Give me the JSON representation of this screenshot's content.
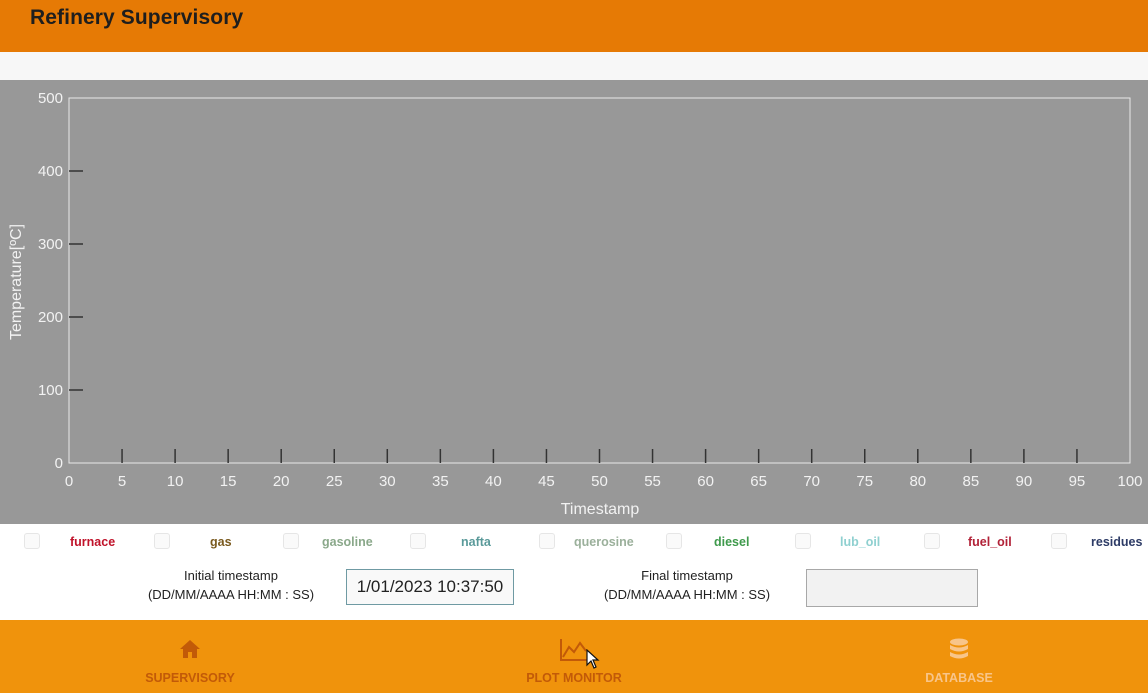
{
  "header": {
    "title": "Refinery Supervisory"
  },
  "colors": {
    "header_bg": "#e67a05",
    "nav_bg": "#f0930c",
    "plot_bg": "#989898"
  },
  "chart_data": {
    "type": "line",
    "xlabel": "Timestamp",
    "ylabel": "Temperature[ºC]",
    "xlim": [
      0,
      100
    ],
    "ylim": [
      0,
      500
    ],
    "x_ticks": [
      0,
      5,
      10,
      15,
      20,
      25,
      30,
      35,
      40,
      45,
      50,
      55,
      60,
      65,
      70,
      75,
      80,
      85,
      90,
      95,
      100
    ],
    "y_ticks": [
      0,
      100,
      200,
      300,
      400,
      500
    ],
    "series": []
  },
  "legend": {
    "items": [
      {
        "label": "furnace",
        "color": "#c0122a"
      },
      {
        "label": "gas",
        "color": "#7a5a1e"
      },
      {
        "label": "gasoline",
        "color": "#8aa88a"
      },
      {
        "label": "nafta",
        "color": "#5a9a9a"
      },
      {
        "label": "querosine",
        "color": "#9bb09b"
      },
      {
        "label": "diesel",
        "color": "#3f9a4c"
      },
      {
        "label": "lub_oil",
        "color": "#8fd0d0"
      },
      {
        "label": "fuel_oil",
        "color": "#b22238"
      },
      {
        "label": "residues",
        "color": "#2d3b66"
      }
    ]
  },
  "filters": {
    "initial_label": "Initial timestamp",
    "initial_format": "(DD/MM/AAAA HH:MM : SS)",
    "initial_value": "1/01/2023 10:37:50",
    "final_label": "Final timestamp",
    "final_format": "(DD/MM/AAAA HH:MM : SS)",
    "final_value": ""
  },
  "nav": {
    "items": [
      {
        "label": "SUPERVISORY",
        "icon": "home-icon",
        "color": "#c25a08"
      },
      {
        "label": "PLOT MONITOR",
        "icon": "line-chart-icon",
        "color": "#c25a08"
      },
      {
        "label": "DATABASE",
        "icon": "database-icon",
        "color": "#f8c58a"
      }
    ]
  }
}
